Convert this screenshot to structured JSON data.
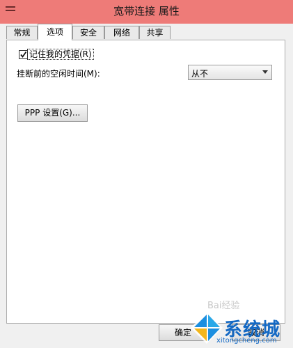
{
  "window": {
    "title": "宽带连接 属性"
  },
  "tabs": [
    {
      "label": "常规",
      "active": false
    },
    {
      "label": "选项",
      "active": true
    },
    {
      "label": "安全",
      "active": false
    },
    {
      "label": "网络",
      "active": false
    },
    {
      "label": "共享",
      "active": false
    }
  ],
  "options": {
    "remember_credentials": {
      "label": "记住我的凭据(R)",
      "checked": true
    },
    "idle_time": {
      "label": "挂断前的空闲时间(M):",
      "value": "从不"
    },
    "ppp_button": "PPP 设置(G)..."
  },
  "footer": {
    "ok": "确定",
    "cancel": "取消"
  },
  "watermark": {
    "brand": "系统城",
    "url": "xitongcheng.com",
    "faint": "Bai经验"
  },
  "colors": {
    "titlebar": "#ee7b78",
    "watermark": "#1469c4"
  }
}
